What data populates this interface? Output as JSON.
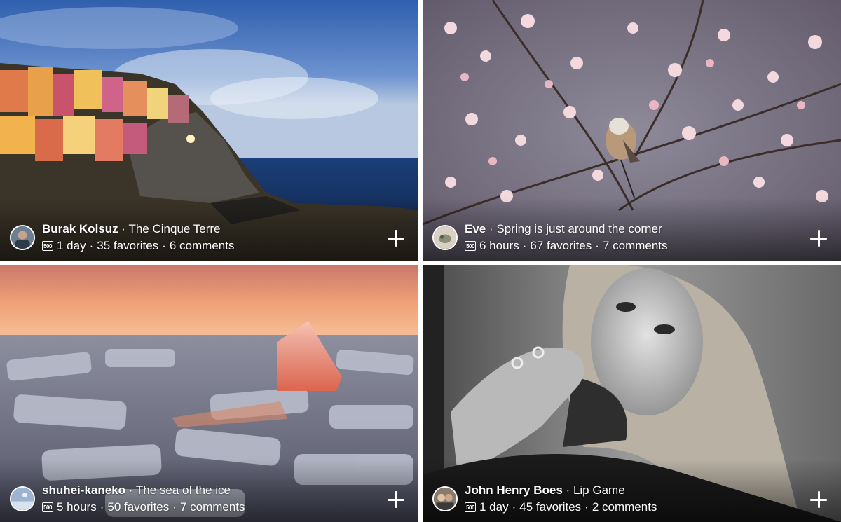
{
  "photos": [
    {
      "author": "Burak Kolsuz",
      "title": "The Cinque Terre",
      "time": "1 day",
      "favorites": "35 favorites",
      "comments": "6 comments",
      "icon": "500px-logo-icon"
    },
    {
      "author": "Eve",
      "title": "Spring is just around the corner",
      "time": "6 hours",
      "favorites": "67 favorites",
      "comments": "7 comments",
      "icon": "500px-logo-icon"
    },
    {
      "author": "shuhei-kaneko",
      "title": "The sea of the ice",
      "time": "5 hours",
      "favorites": "50 favorites",
      "comments": "7 comments",
      "icon": "500px-logo-icon"
    },
    {
      "author": "John Henry Boes",
      "title": "Lip Game",
      "time": "1 day",
      "favorites": "45 favorites",
      "comments": "2 comments",
      "icon": "500px-logo-icon"
    }
  ],
  "separator": "·",
  "logo_text": "500",
  "colors": {
    "text": "#ffffff",
    "background": "#ffffff"
  }
}
